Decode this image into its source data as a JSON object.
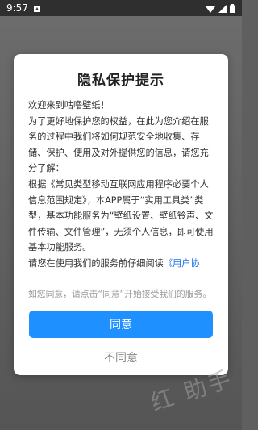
{
  "status_bar": {
    "time": "9:57"
  },
  "dialog": {
    "title": "隐私保护提示",
    "paragraphs": {
      "p1": "欢迎来到咕噜壁纸！",
      "p2": "为了更好地保护您的权益，在此为您介绍在服务的过程中我们将如何规范安全地收集、存储、保护、使用及对外提供您的信息，请您充分了解：",
      "p3": "根据《常见类型移动互联网应用程序必要个人信息范围规定》，本APP属于“实用工具类”类型，基本功能服务为“壁纸设置、壁纸铃声、文件传输、文件管理”，无须个人信息，即可使用基本功能服务。",
      "p4_prefix": "请您在使用我们的服务前仔细阅读",
      "p4_link": "《用户协"
    },
    "consent_hint": "如您同意，请点击“同意”开始接受我们的服务。",
    "agree_label": "同意",
    "disagree_label": "不同意"
  },
  "watermark": "红 助手",
  "colors": {
    "accent": "#1e90ff",
    "link": "#1a73e8"
  }
}
